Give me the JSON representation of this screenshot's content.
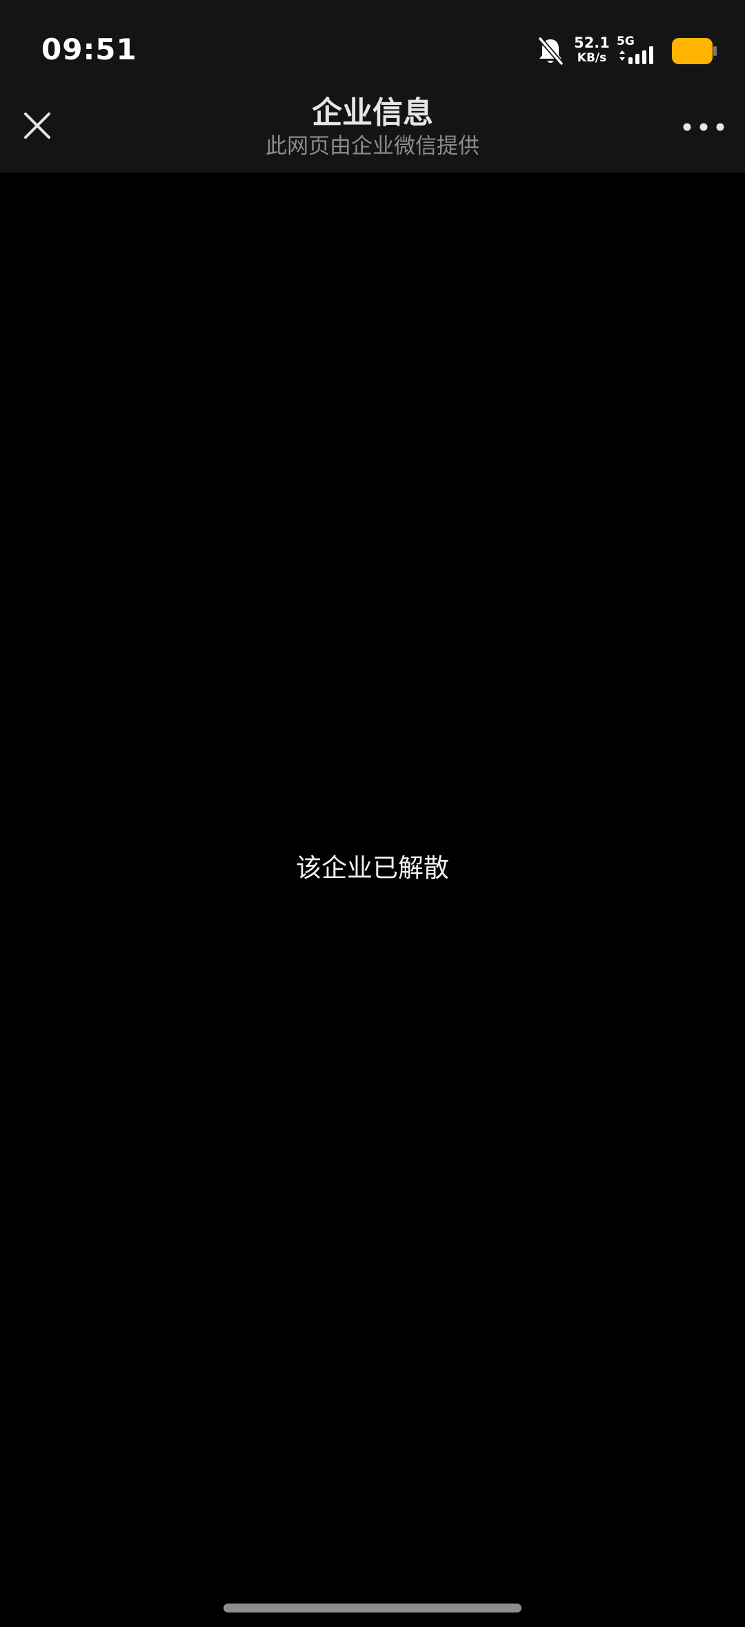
{
  "status_bar": {
    "time": "09:51",
    "net_speed_value": "52.1",
    "net_speed_unit": "KB/s",
    "network_type": "5G",
    "icons": [
      "bell-muted-icon",
      "signal-icon",
      "battery-icon"
    ],
    "battery_color": "#FFB400"
  },
  "nav": {
    "title": "企业信息",
    "subtitle": "此网页由企业微信提供",
    "icons": [
      "close-icon",
      "more-icon"
    ]
  },
  "content": {
    "message": "该企业已解散"
  },
  "colors": {
    "background": "#000000",
    "bar_background": "#141414",
    "title_text": "#E6E6E6",
    "subtitle_text": "#8C8C8C",
    "message_text": "#F2F2F2"
  }
}
